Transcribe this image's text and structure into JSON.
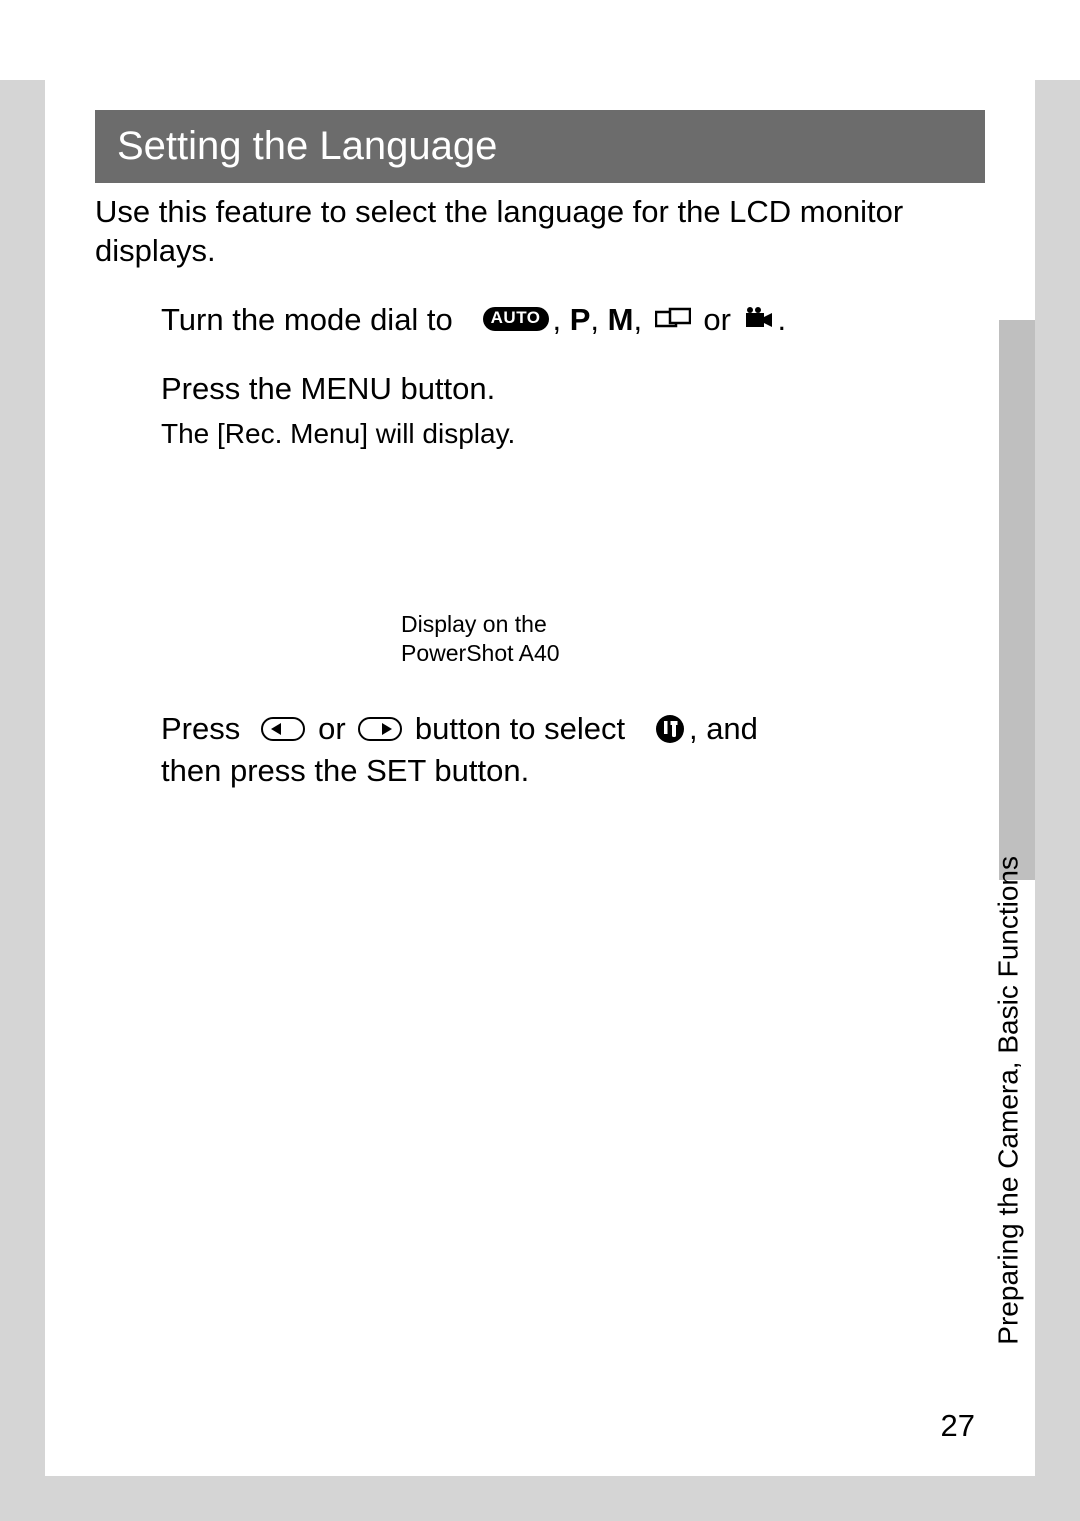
{
  "section_title": "Setting the Language",
  "intro": "Use this feature to select the language for the LCD monitor displays.",
  "step1": {
    "prefix": "Turn the mode dial to   ",
    "auto_label": "AUTO",
    "sep1": ", ",
    "p": "P",
    "sep2": ", ",
    "m": "M",
    "sep3": ", ",
    "or": " or ",
    "end": "."
  },
  "step2": {
    "line": "Press the MENU button.",
    "sub": "The [Rec. Menu] will display."
  },
  "caption": {
    "l1": "Display on the",
    "l2": "PowerShot A40"
  },
  "step3": {
    "t1": "Press  ",
    "t2": " or ",
    "t3": " button to select   ",
    "t4": ", and",
    "t5": "then press the SET button."
  },
  "side_label": "Preparing the Camera, Basic Functions",
  "page_number": "27"
}
